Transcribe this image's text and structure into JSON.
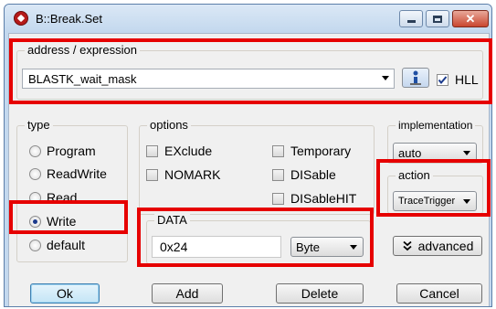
{
  "window": {
    "title": "B::Break.Set"
  },
  "address": {
    "legend": "address / expression",
    "value": "BLASTK_wait_mask",
    "hll_label": "HLL",
    "hll_checked": true
  },
  "type": {
    "legend": "type",
    "options": [
      "Program",
      "ReadWrite",
      "Read",
      "Write",
      "default"
    ],
    "selected": "Write"
  },
  "options": {
    "legend": "options",
    "left": [
      "EXclude",
      "NOMARK"
    ],
    "right": [
      "Temporary",
      "DISable",
      "DISableHIT"
    ]
  },
  "data": {
    "legend": "DATA",
    "value": "0x24",
    "width": "Byte"
  },
  "implementation": {
    "legend": "implementation",
    "value": "auto"
  },
  "action": {
    "legend": "action",
    "value": "TraceTrigger"
  },
  "advanced_label": "advanced",
  "buttons": {
    "ok": "Ok",
    "add": "Add",
    "delete": "Delete",
    "cancel": "Cancel"
  },
  "colors": {
    "highlight": "#e60000",
    "titlebar": "#c3d8ee",
    "dialog_bg": "#f0f0f0"
  }
}
